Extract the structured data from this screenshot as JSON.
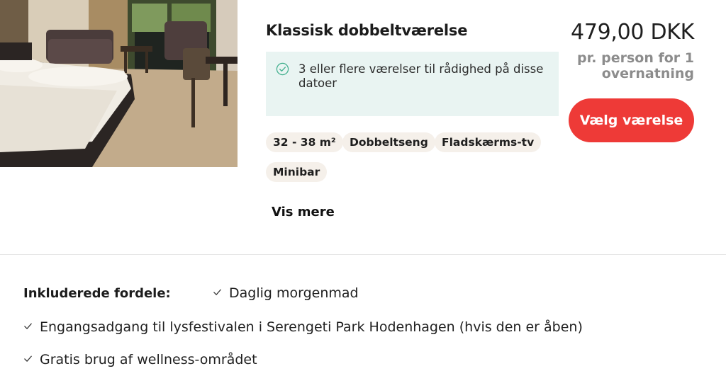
{
  "room": {
    "title": "Klassisk dobbeltværelse",
    "availability": "3 eller flere værelser til rådighed på disse datoer",
    "features": [
      "32 - 38 m²",
      "Dobbeltseng",
      "Fladskærms-tv",
      "Minibar"
    ],
    "show_more": "Vis mere",
    "image_icon": "room-photo"
  },
  "pricing": {
    "price": "479,00 DKK",
    "per": "pr. person for 1 overnatning",
    "select_label": "Vælg værelse",
    "button_color": "#ee3a37"
  },
  "included": {
    "label": "Inkluderede fordele:",
    "items": [
      "Daglig morgenmad",
      "Engangsadgang til lysfestivalen i Serengeti Park Hodenhagen (hvis den er åben)",
      "Gratis brug af wellness-området"
    ]
  },
  "colors": {
    "availability_bg": "#e9f4f2",
    "availability_check": "#3fae8c",
    "chip_bg": "#f5f0ea"
  }
}
